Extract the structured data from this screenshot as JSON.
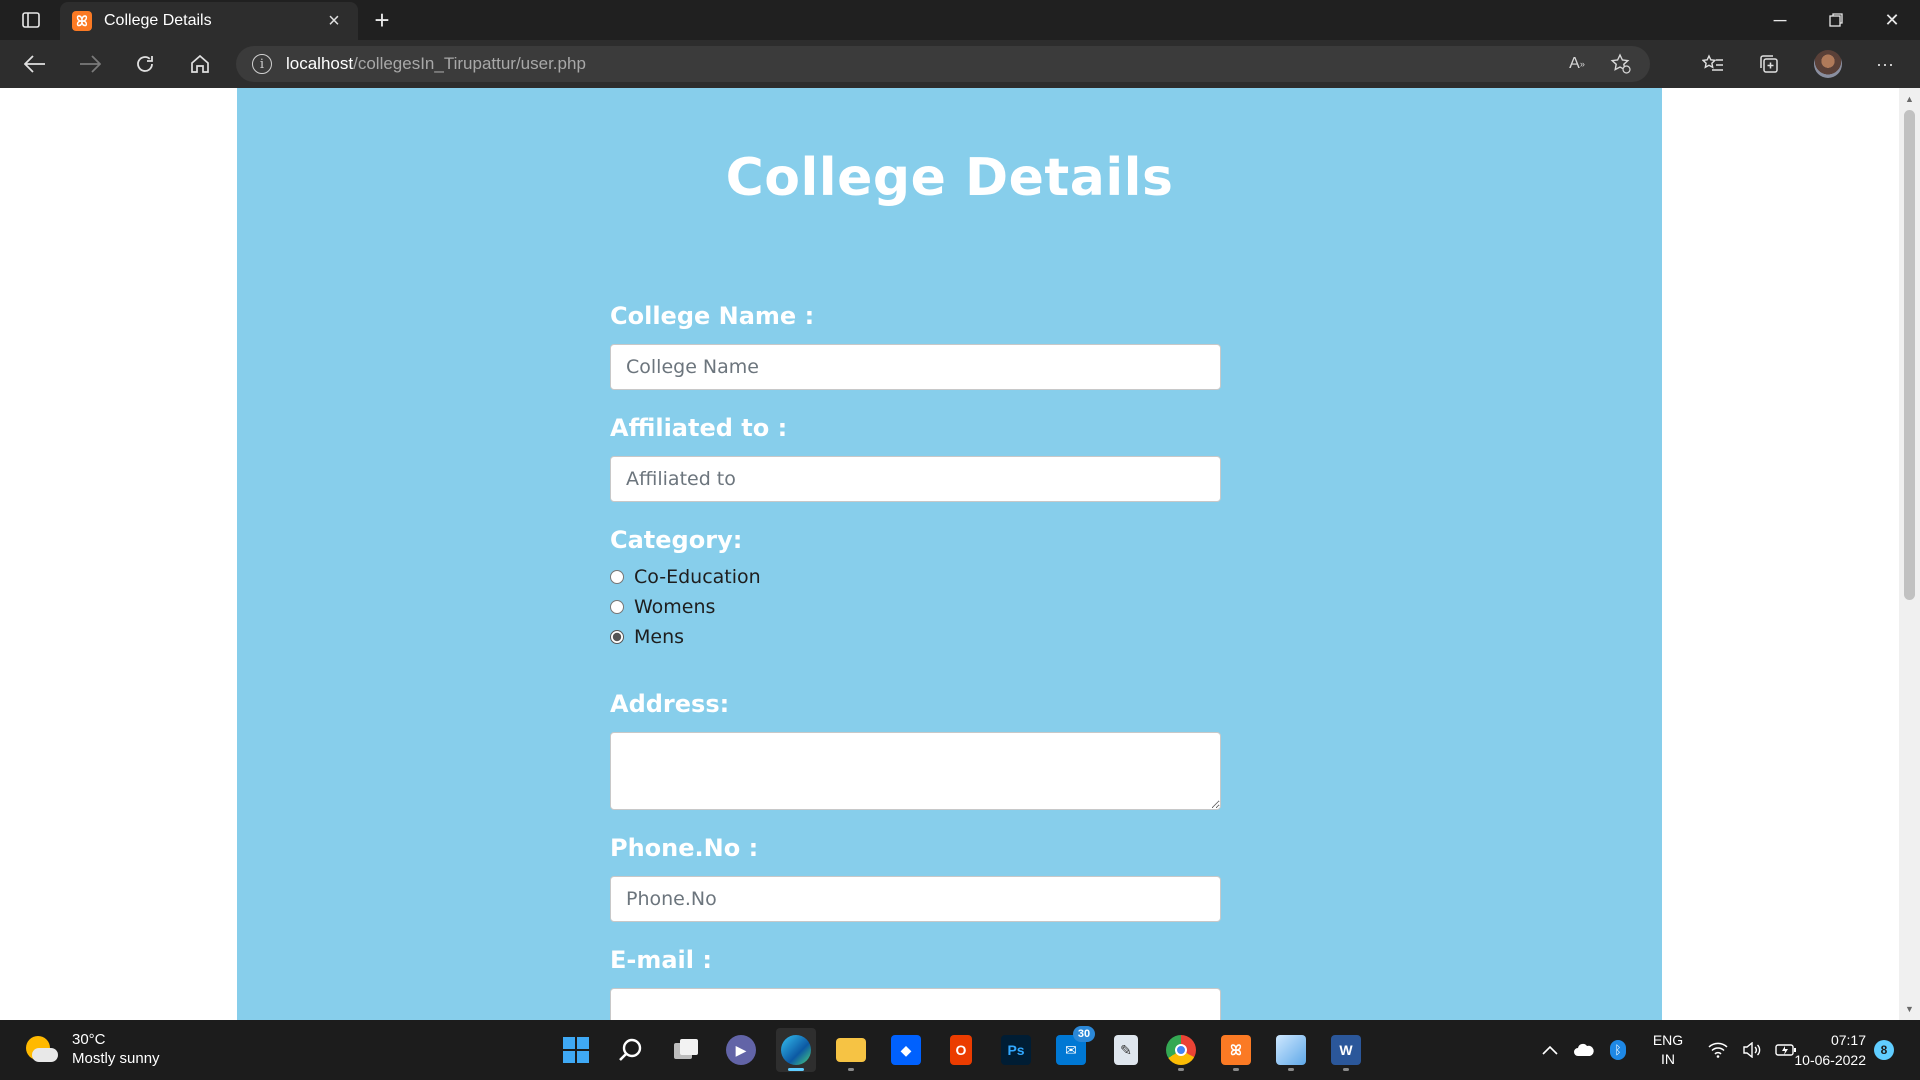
{
  "browser": {
    "tab_title": "College Details",
    "url_host": "localhost",
    "url_path": "/collegesIn_Tirupattur/user.php"
  },
  "page": {
    "title": "College Details",
    "background_color": "#87ceeb",
    "form": {
      "college_name": {
        "label": "College Name :",
        "placeholder": "College Name",
        "value": ""
      },
      "affiliated_to": {
        "label": "Affiliated to :",
        "placeholder": "Affiliated to",
        "value": ""
      },
      "category": {
        "label": "Category:",
        "options": [
          "Co-Education",
          "Womens",
          "Mens"
        ],
        "selected": "Mens"
      },
      "address": {
        "label": "Address:",
        "value": ""
      },
      "phone": {
        "label": "Phone.No :",
        "placeholder": "Phone.No",
        "value": ""
      },
      "email": {
        "label": "E-mail :"
      }
    }
  },
  "taskbar": {
    "weather_temp": "30°C",
    "weather_desc": "Mostly sunny",
    "apps": [
      "start",
      "search",
      "task-view",
      "teams-chat",
      "edge",
      "file-explorer",
      "dropbox",
      "office",
      "photoshop",
      "mail",
      "notepad",
      "chrome",
      "xampp",
      "3d-box",
      "word"
    ],
    "active_app": "edge",
    "mail_badge": "30",
    "lang_line1": "ENG",
    "lang_line2": "IN",
    "time": "07:17",
    "date": "10-06-2022",
    "notifications": "8"
  }
}
